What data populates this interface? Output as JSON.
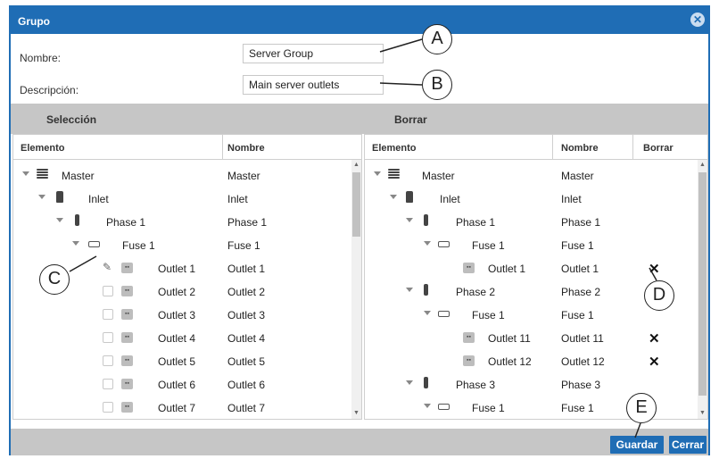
{
  "dialog": {
    "title": "Grupo"
  },
  "form": {
    "name_label": "Nombre:",
    "name_value": "Server Group",
    "description_label": "Descripción:",
    "description_value": "Main server outlets"
  },
  "sections": {
    "selection": "Selección",
    "delete": "Borrar"
  },
  "left_panel": {
    "columns": [
      "Elemento",
      "Nombre"
    ],
    "rows": [
      {
        "element": "Master",
        "name": "Master"
      },
      {
        "element": "Inlet",
        "name": "Inlet"
      },
      {
        "element": "Phase 1",
        "name": "Phase 1"
      },
      {
        "element": "Fuse 1",
        "name": "Fuse 1"
      },
      {
        "element": "Outlet 1",
        "name": "Outlet 1"
      },
      {
        "element": "Outlet 2",
        "name": "Outlet 2"
      },
      {
        "element": "Outlet 3",
        "name": "Outlet 3"
      },
      {
        "element": "Outlet 4",
        "name": "Outlet 4"
      },
      {
        "element": "Outlet 5",
        "name": "Outlet 5"
      },
      {
        "element": "Outlet 6",
        "name": "Outlet 6"
      },
      {
        "element": "Outlet 7",
        "name": "Outlet 7"
      }
    ]
  },
  "right_panel": {
    "columns": [
      "Elemento",
      "Nombre",
      "Borrar"
    ],
    "rows": [
      {
        "element": "Master",
        "name": "Master"
      },
      {
        "element": "Inlet",
        "name": "Inlet"
      },
      {
        "element": "Phase 1",
        "name": "Phase 1"
      },
      {
        "element": "Fuse 1",
        "name": "Fuse 1"
      },
      {
        "element": "Outlet 1",
        "name": "Outlet 1"
      },
      {
        "element": "Phase 2",
        "name": "Phase 2"
      },
      {
        "element": "Fuse 1",
        "name": "Fuse 1"
      },
      {
        "element": "Outlet 11",
        "name": "Outlet 11"
      },
      {
        "element": "Outlet 12",
        "name": "Outlet 12"
      },
      {
        "element": "Phase 3",
        "name": "Phase 3"
      },
      {
        "element": "Fuse 1",
        "name": "Fuse 1"
      }
    ]
  },
  "buttons": {
    "save": "Guardar",
    "close": "Cerrar"
  },
  "callouts": {
    "a": "A",
    "b": "B",
    "c": "C",
    "d": "D",
    "e": "E"
  },
  "icons": {
    "close": "close-circle-icon",
    "master": "master-device-icon",
    "inlet": "inlet-icon",
    "phase": "phase-icon",
    "fuse": "fuse-icon",
    "outlet": "outlet-icon",
    "edit": "pencil-icon",
    "delete": "x-mark-icon"
  },
  "colors": {
    "accent": "#1f6db5",
    "section_bar": "#c6c6c6"
  }
}
